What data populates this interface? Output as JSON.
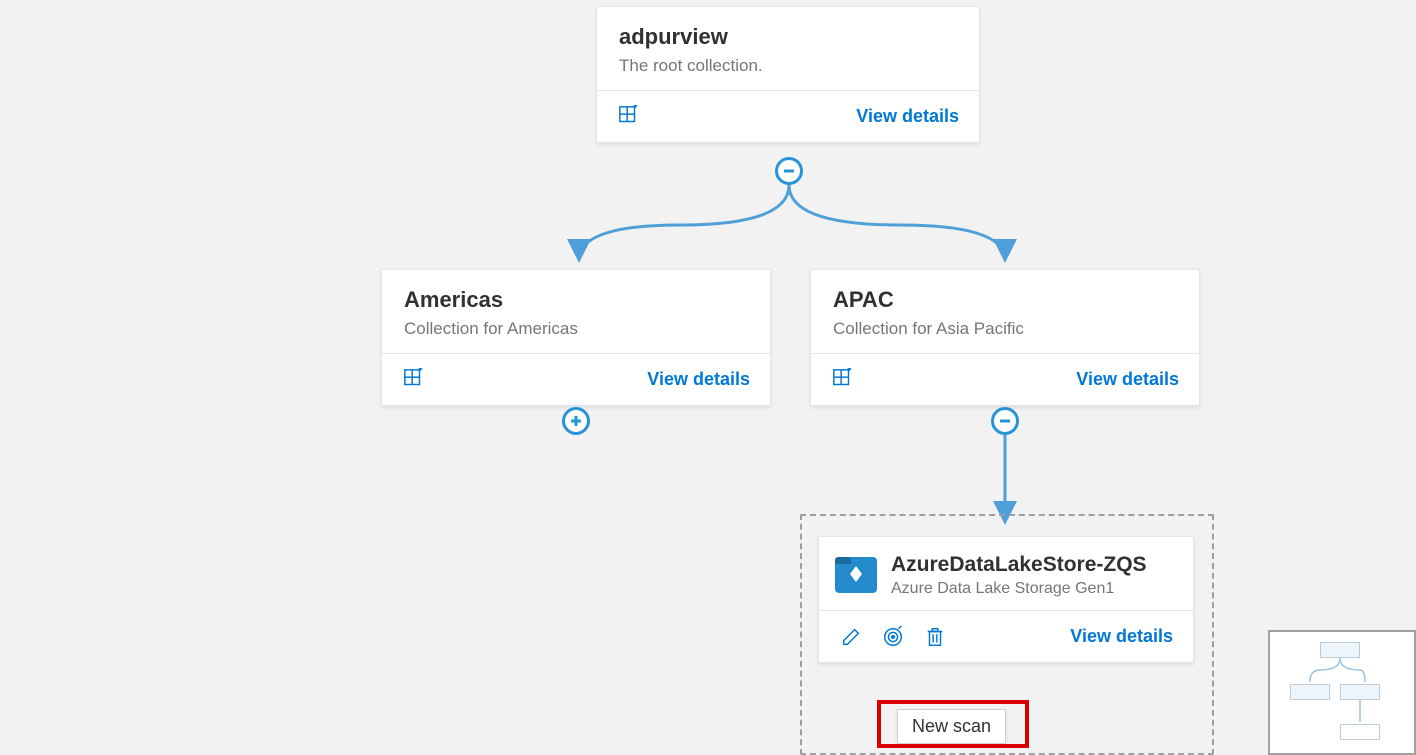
{
  "root": {
    "title": "adpurview",
    "subtitle": "The root collection.",
    "view_details": "View details"
  },
  "collections": [
    {
      "title": "Americas",
      "subtitle": "Collection for Americas",
      "view_details": "View details"
    },
    {
      "title": "APAC",
      "subtitle": "Collection for Asia Pacific",
      "view_details": "View details"
    }
  ],
  "data_source": {
    "title": "AzureDataLakeStore-ZQS",
    "subtitle": "Azure Data Lake Storage Gen1",
    "view_details": "View details"
  },
  "tooltip": "New scan",
  "colors": {
    "accent": "#0078d4",
    "connector": "#4f9fd9",
    "icon_bg": "#258bcf"
  }
}
